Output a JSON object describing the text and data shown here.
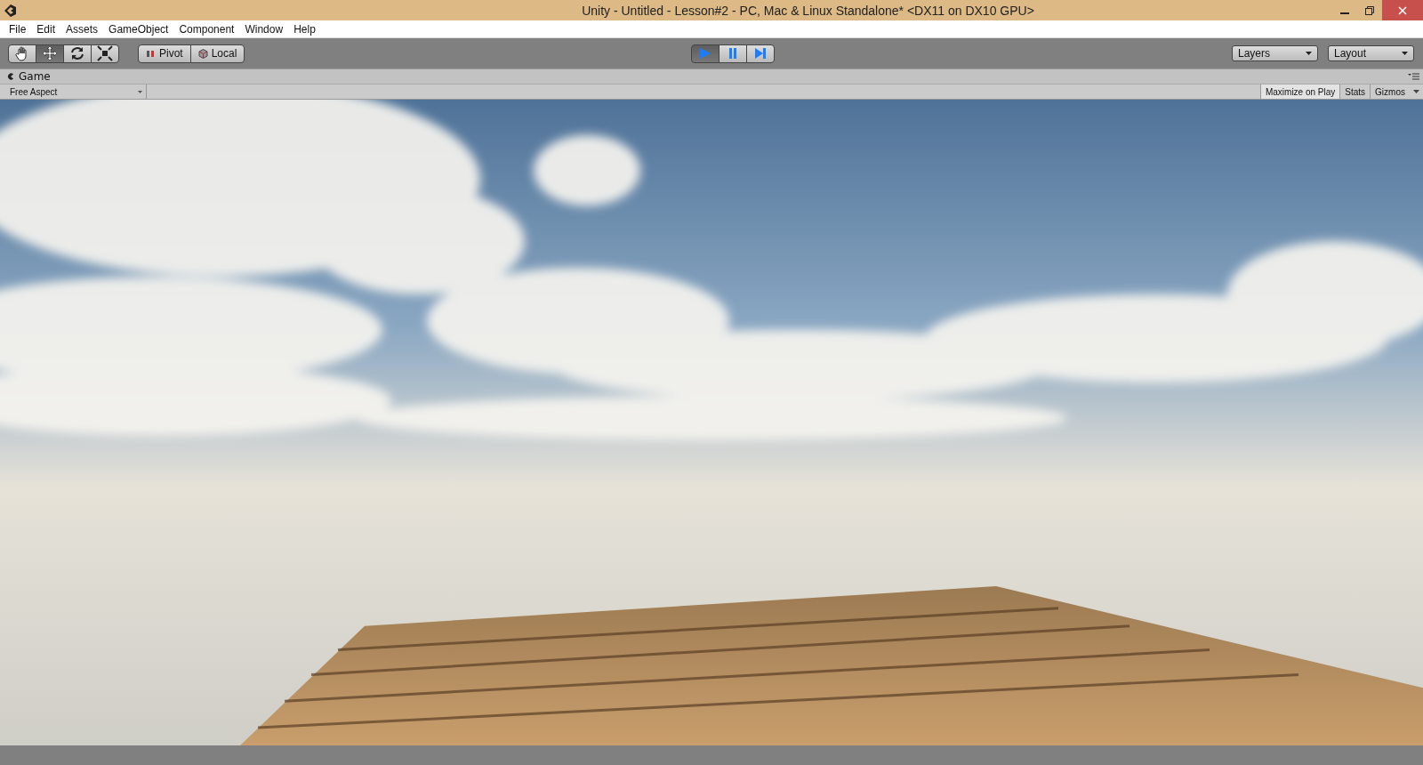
{
  "window": {
    "title": "Unity - Untitled - Lesson#2 - PC, Mac & Linux Standalone* <DX11 on DX10 GPU>"
  },
  "menu": [
    "File",
    "Edit",
    "Assets",
    "GameObject",
    "Component",
    "Window",
    "Help"
  ],
  "tools": [
    {
      "kind": "hand",
      "selected": false
    },
    {
      "kind": "move",
      "selected": true
    },
    {
      "kind": "rotate",
      "selected": false
    },
    {
      "kind": "scale",
      "selected": false
    }
  ],
  "pivot_buttons": [
    {
      "kind": "pivot",
      "label": "Pivot"
    },
    {
      "kind": "local",
      "label": "Local"
    }
  ],
  "play_controls": [
    {
      "kind": "play",
      "selected": true
    },
    {
      "kind": "pause",
      "selected": false
    },
    {
      "kind": "step",
      "selected": false
    }
  ],
  "dropdowns": [
    "Layers",
    "Layout"
  ],
  "game_panel": {
    "tab": "Game",
    "aspect": "Free Aspect",
    "toggles": [
      {
        "label": "Maximize on Play",
        "selected": true
      },
      {
        "label": "Stats",
        "selected": false
      },
      {
        "label": "Gizmos",
        "selected": false
      }
    ]
  }
}
